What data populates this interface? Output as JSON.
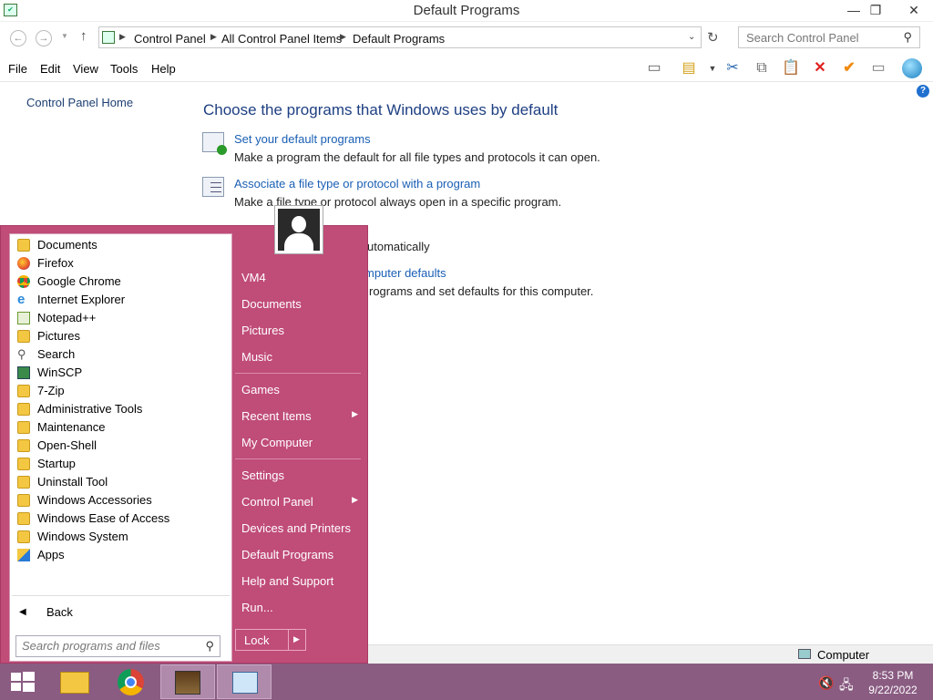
{
  "window": {
    "title": "Default Programs",
    "controls": {
      "minimize": "—",
      "maximize": "❐",
      "close": "✕"
    }
  },
  "address": {
    "breadcrumbs": [
      "Control Panel",
      "All Control Panel Items",
      "Default Programs"
    ],
    "search_placeholder": "Search Control Panel"
  },
  "menu": [
    "File",
    "Edit",
    "View",
    "Tools",
    "Help"
  ],
  "nav": {
    "home": "Control Panel Home"
  },
  "content": {
    "heading": "Choose the programs that Windows uses by default",
    "tasks": [
      {
        "link": "Set your default programs",
        "desc": "Make a program the default for all file types and protocols it can open."
      },
      {
        "link": "Associate a file type or protocol with a program",
        "desc": "Make a file type or protocol always open in a specific program."
      },
      {
        "link": "",
        "desc": "utomatically"
      },
      {
        "link": "mputer defaults",
        "desc": "rograms and set defaults for this computer."
      }
    ]
  },
  "start_menu": {
    "programs": [
      {
        "label": "Documents",
        "icon": "documents-folder-icon"
      },
      {
        "label": "Firefox",
        "icon": "firefox-icon"
      },
      {
        "label": "Google Chrome",
        "icon": "chrome-icon"
      },
      {
        "label": "Internet Explorer",
        "icon": "internet-explorer-icon"
      },
      {
        "label": "Notepad++",
        "icon": "notepadpp-icon"
      },
      {
        "label": "Pictures",
        "icon": "pictures-folder-icon"
      },
      {
        "label": "Search",
        "icon": "search-icon"
      },
      {
        "label": "WinSCP",
        "icon": "winscp-icon"
      },
      {
        "label": "7-Zip",
        "icon": "folder-icon"
      },
      {
        "label": "Administrative Tools",
        "icon": "folder-icon"
      },
      {
        "label": "Maintenance",
        "icon": "folder-icon"
      },
      {
        "label": "Open-Shell",
        "icon": "folder-icon"
      },
      {
        "label": "Startup",
        "icon": "folder-icon"
      },
      {
        "label": "Uninstall Tool",
        "icon": "folder-icon"
      },
      {
        "label": "Windows Accessories",
        "icon": "folder-icon"
      },
      {
        "label": "Windows Ease of Access",
        "icon": "folder-icon"
      },
      {
        "label": "Windows System",
        "icon": "folder-icon"
      },
      {
        "label": "Apps",
        "icon": "apps-icon"
      }
    ],
    "back": "Back",
    "search_placeholder": "Search programs and files",
    "right_items": [
      "VM4",
      "Documents",
      "Pictures",
      "Music",
      "Games",
      "Recent Items",
      "My Computer",
      "Settings",
      "Control Panel",
      "Devices and Printers",
      "Default Programs",
      "Help and Support",
      "Run..."
    ],
    "lock": "Lock"
  },
  "status": {
    "computer": "Computer"
  },
  "taskbar": {
    "time": "8:53 PM",
    "date": "9/22/2022",
    "apps": [
      "start-button",
      "file-explorer-icon",
      "chrome-icon",
      "archive-app-icon",
      "control-panel-icon"
    ]
  },
  "colors": {
    "start_menu_bg": "#c04c78",
    "taskbar_bg": "#8a5c82",
    "link": "#1a5fb4",
    "heading": "#1e3f82"
  }
}
